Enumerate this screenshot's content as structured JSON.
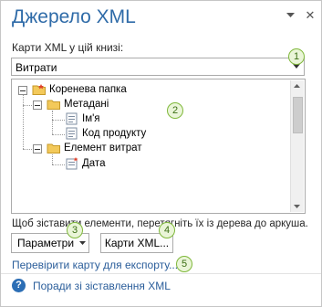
{
  "pane": {
    "title": "Джерело XML",
    "close_glyph": "✕"
  },
  "maps": {
    "label": "Карти XML у цій книзі:",
    "selected": "Витрати"
  },
  "badges": [
    "1",
    "2",
    "3",
    "4",
    "5"
  ],
  "tree": {
    "root": "Коренева папка",
    "metadata": "Метадані",
    "name": "Ім'я",
    "product_code": "Код продукту",
    "expense_item": "Елемент витрат",
    "date": "Дата"
  },
  "hint": "Щоб зіставити елементи, перетягніть їх із дерева до аркуша.",
  "buttons": {
    "options": "Параметри",
    "xml_maps": "Карти XML..."
  },
  "links": {
    "verify_export": "Перевірити карту для експорту...",
    "mapping_tips": "Поради зі зіставлення XML"
  },
  "colors": {
    "title": "#2f6ba8",
    "link": "#2a5d9a",
    "badge_border": "#7fb83a",
    "folder": "#f3c95a",
    "element_marker": "#e0402a"
  }
}
